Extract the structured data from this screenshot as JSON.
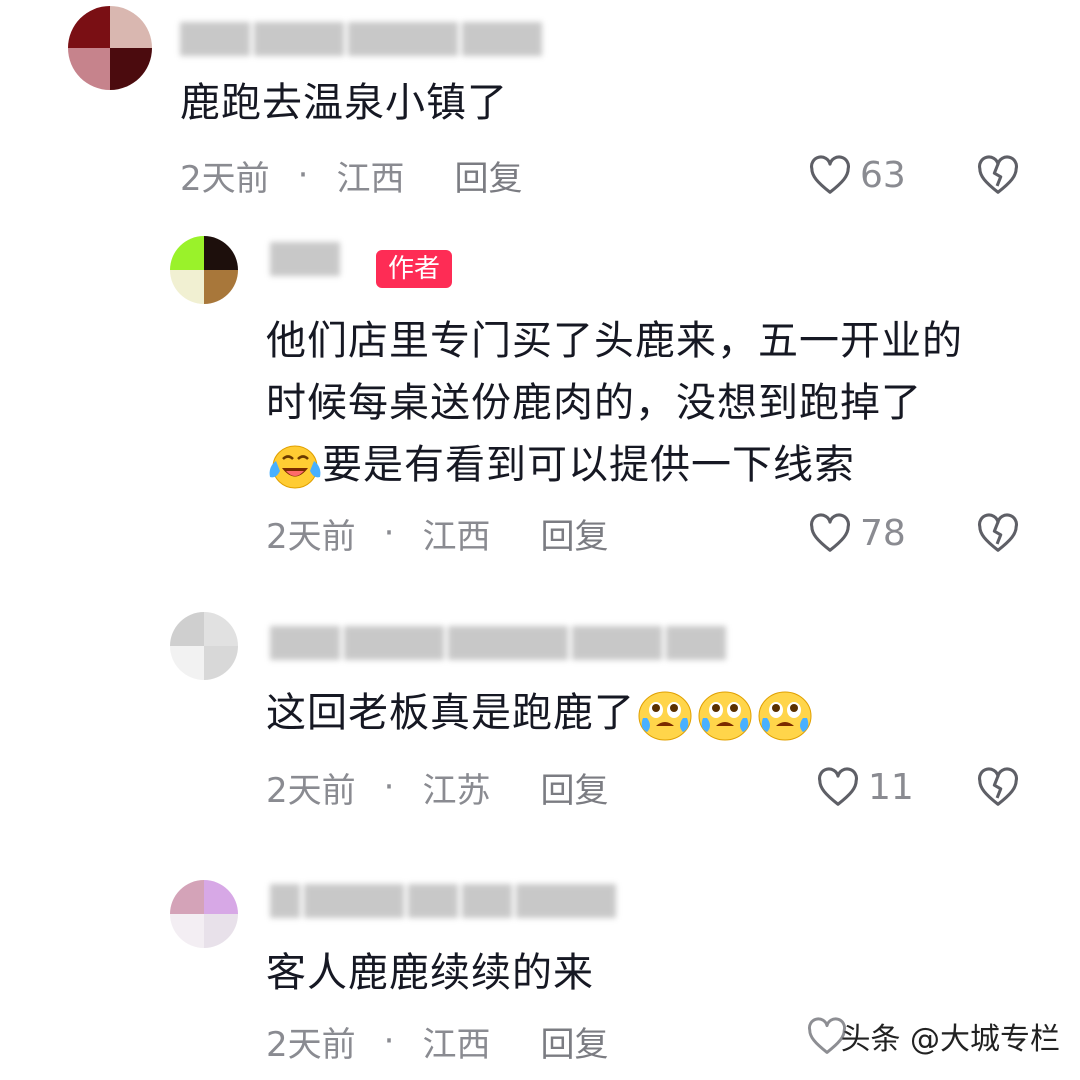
{
  "comments": [
    {
      "text": "鹿跑去温泉小镇了",
      "time": "2天前",
      "location": "江西",
      "reply_label": "回复",
      "likes": "63"
    },
    {
      "badge": "作者",
      "text_line1": "他们店里专门买了头鹿来，五一开业的",
      "text_line2": "时候每桌送份鹿肉的，没想到跑掉了",
      "text_line3": "要是有看到可以提供一下线索",
      "time": "2天前",
      "location": "江西",
      "reply_label": "回复",
      "likes": "78"
    },
    {
      "text": "这回老板真是跑鹿了",
      "time": "2天前",
      "location": "江苏",
      "reply_label": "回复",
      "likes": "11"
    },
    {
      "text": "客人鹿鹿续续的来",
      "time": "2天前",
      "location": "江西",
      "reply_label": "回复"
    }
  ],
  "watermark": "头条 @大城专栏",
  "colors": {
    "badge": "#fe2c55",
    "meta": "#8a8b91",
    "text": "#161823"
  },
  "icons": [
    "heart-icon",
    "broken-heart-icon",
    "laughing-tears-emoji",
    "crying-emoji"
  ]
}
